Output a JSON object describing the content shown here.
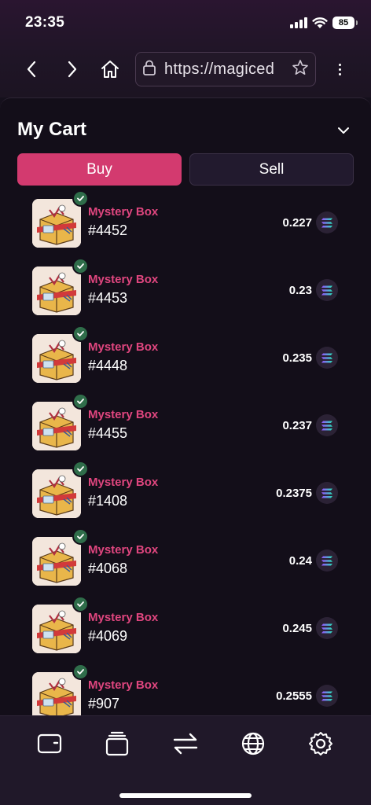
{
  "status_bar": {
    "time": "23:35",
    "battery": "85"
  },
  "browser": {
    "url": "https://magiced"
  },
  "cart": {
    "title": "My Cart",
    "tabs": {
      "buy": "Buy",
      "sell": "Sell"
    },
    "items": [
      {
        "name": "Mystery Box",
        "id": "#4452",
        "price": "0.227"
      },
      {
        "name": "Mystery Box",
        "id": "#4453",
        "price": "0.23"
      },
      {
        "name": "Mystery Box",
        "id": "#4448",
        "price": "0.235"
      },
      {
        "name": "Mystery Box",
        "id": "#4455",
        "price": "0.237"
      },
      {
        "name": "Mystery Box",
        "id": "#1408",
        "price": "0.2375"
      },
      {
        "name": "Mystery Box",
        "id": "#4068",
        "price": "0.24"
      },
      {
        "name": "Mystery Box",
        "id": "#4069",
        "price": "0.245"
      },
      {
        "name": "Mystery Box",
        "id": "#907",
        "price": "0.2555"
      }
    ]
  },
  "tabbar": {
    "icons": [
      "wallet-icon",
      "collection-icon",
      "swap-icon",
      "globe-icon",
      "settings-icon"
    ]
  },
  "colors": {
    "accent": "#d33a6f",
    "item_name": "#e0467f",
    "background": "#130e19",
    "check": "#2f6d4a"
  }
}
